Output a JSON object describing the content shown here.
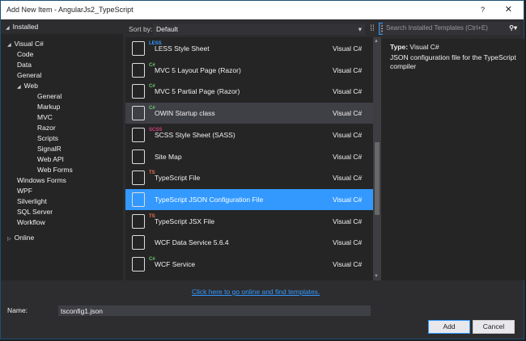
{
  "window": {
    "title": "Add New Item - AngularJs2_TypeScript",
    "help": "?",
    "close": "✕"
  },
  "tree": {
    "installed": "Installed",
    "items": [
      {
        "label": "Visual C#",
        "level": 1,
        "expanded": true
      },
      {
        "label": "Code",
        "level": 2
      },
      {
        "label": "Data",
        "level": 2
      },
      {
        "label": "General",
        "level": 2
      },
      {
        "label": "Web",
        "level": 2,
        "expanded": true
      },
      {
        "label": "General",
        "level": 3
      },
      {
        "label": "Markup",
        "level": 3
      },
      {
        "label": "MVC",
        "level": 3
      },
      {
        "label": "Razor",
        "level": 3
      },
      {
        "label": "Scripts",
        "level": 3
      },
      {
        "label": "SignalR",
        "level": 3
      },
      {
        "label": "Web API",
        "level": 3
      },
      {
        "label": "Web Forms",
        "level": 3
      },
      {
        "label": "Windows Forms",
        "level": 2
      },
      {
        "label": "WPF",
        "level": 2
      },
      {
        "label": "Silverlight",
        "level": 2
      },
      {
        "label": "SQL Server",
        "level": 2
      },
      {
        "label": "Workflow",
        "level": 2
      }
    ],
    "online": "Online"
  },
  "toolbar": {
    "sort_label": "Sort by:",
    "sort_value": "Default"
  },
  "templates": [
    {
      "name": "LESS Style Sheet",
      "lang": "Visual C#",
      "badge": "LESS",
      "badge_color": "#3399ff"
    },
    {
      "name": "MVC 5 Layout Page (Razor)",
      "lang": "Visual C#",
      "badge": "C#",
      "badge_color": "#6cc26c"
    },
    {
      "name": "MVC 5 Partial Page (Razor)",
      "lang": "Visual C#",
      "badge": "C#",
      "badge_color": "#6cc26c"
    },
    {
      "name": "OWIN Startup class",
      "lang": "Visual C#",
      "badge": "C#",
      "badge_color": "#6cc26c",
      "state": "hover"
    },
    {
      "name": "SCSS Style Sheet (SASS)",
      "lang": "Visual C#",
      "badge": "SCSS",
      "badge_color": "#c9427f"
    },
    {
      "name": "Site Map",
      "lang": "Visual C#",
      "badge": "",
      "badge_color": ""
    },
    {
      "name": "TypeScript File",
      "lang": "Visual C#",
      "badge": "TS",
      "badge_color": "#e8734a"
    },
    {
      "name": "TypeScript JSON Configuration File",
      "lang": "Visual C#",
      "badge": "",
      "badge_color": "",
      "state": "selected"
    },
    {
      "name": "TypeScript JSX File",
      "lang": "Visual C#",
      "badge": "TS",
      "badge_color": "#e8734a"
    },
    {
      "name": "WCF Data Service 5.6.4",
      "lang": "Visual C#",
      "badge": "",
      "badge_color": ""
    },
    {
      "name": "WCF Service",
      "lang": "Visual C#",
      "badge": "C#",
      "badge_color": "#6cc26c"
    }
  ],
  "search": {
    "placeholder": "Search Installed Templates (Ctrl+E)"
  },
  "details": {
    "type_label": "Type:",
    "type_value": "Visual C#",
    "description": "JSON configuration file for the TypeScript compiler"
  },
  "online_link": "Click here to go online and find templates.",
  "name_field": {
    "label": "Name:",
    "value": "tsconfig1.json"
  },
  "buttons": {
    "add": "Add",
    "cancel": "Cancel"
  }
}
